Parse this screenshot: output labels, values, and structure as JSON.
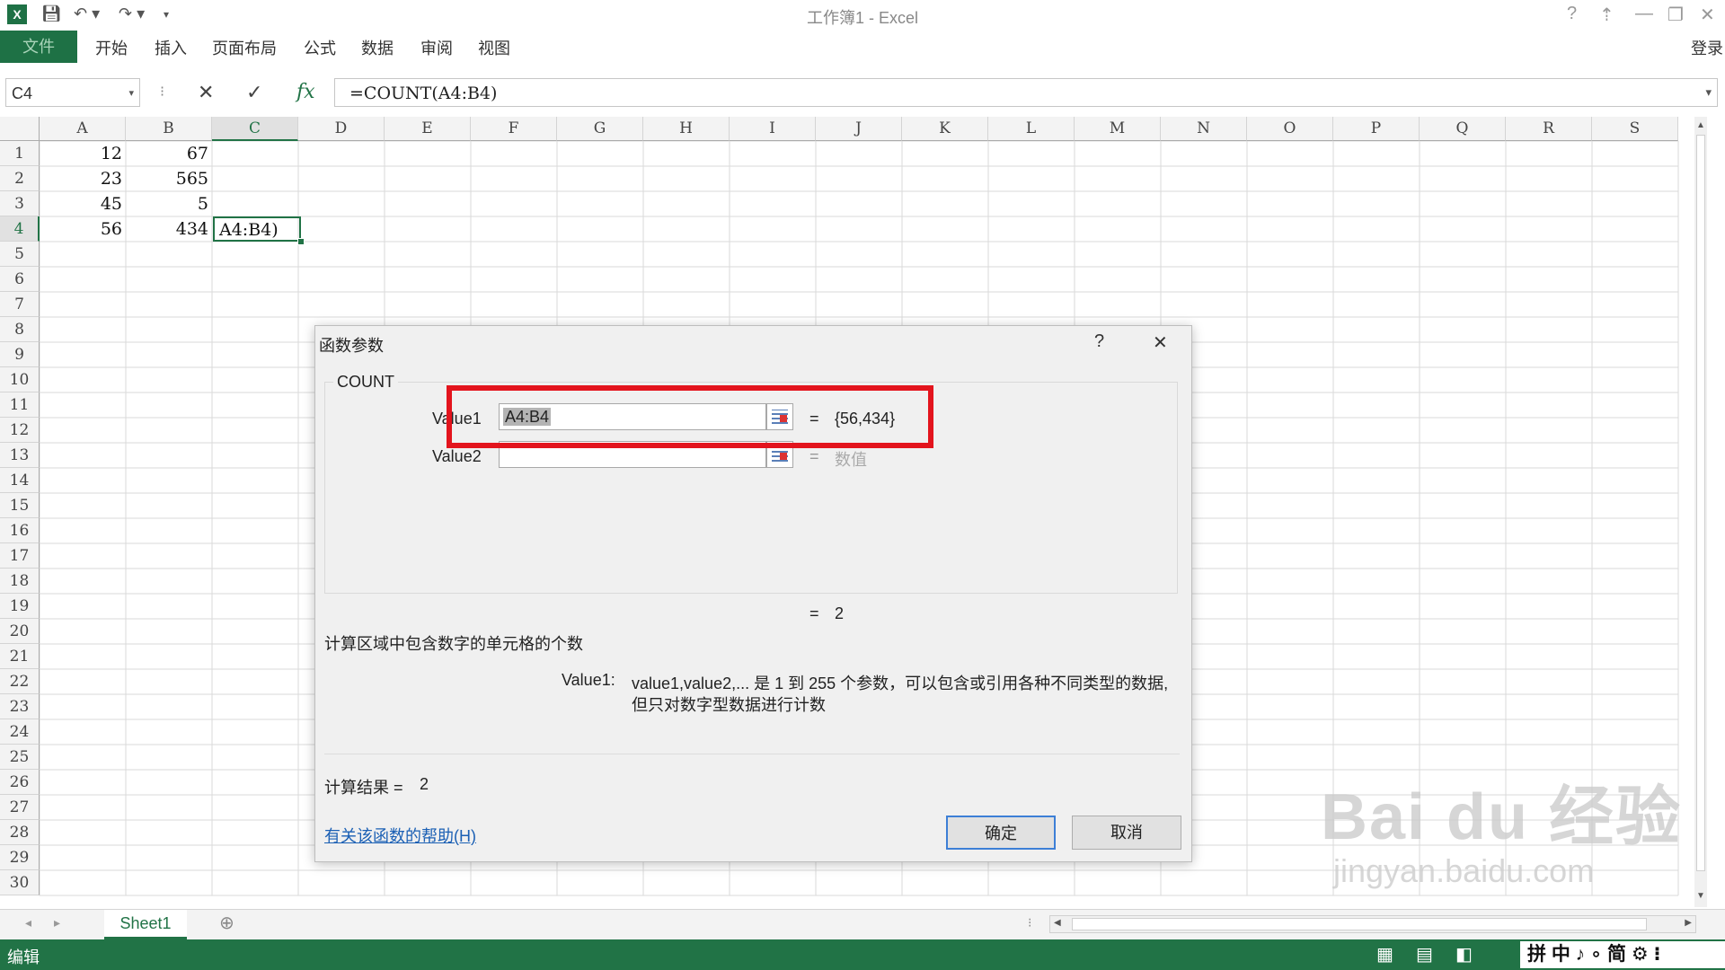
{
  "window": {
    "title": "工作簿1 - Excel",
    "login": "登录"
  },
  "ribbon": {
    "tabs": [
      "文件",
      "开始",
      "插入",
      "页面布局",
      "公式",
      "数据",
      "审阅",
      "视图"
    ]
  },
  "formula_bar": {
    "name_box": "C4",
    "formula": "=COUNT(A4:B4)"
  },
  "grid": {
    "columns": [
      "A",
      "B",
      "C",
      "D",
      "E",
      "F",
      "G",
      "H",
      "I",
      "J",
      "K",
      "L",
      "M",
      "N",
      "O",
      "P",
      "Q",
      "R",
      "S"
    ],
    "rows": [
      "1",
      "2",
      "3",
      "4",
      "5",
      "6",
      "7",
      "8",
      "9",
      "10",
      "11",
      "12",
      "13",
      "14",
      "15",
      "16",
      "17",
      "18",
      "19",
      "20",
      "21",
      "22",
      "23",
      "24",
      "25",
      "26",
      "27",
      "28",
      "29",
      "30"
    ],
    "active_cell": "C4",
    "cells": {
      "a1": "12",
      "b1": "67",
      "a2": "23",
      "b2": "565",
      "a3": "45",
      "b3": "5",
      "a4": "56",
      "b4": "434",
      "c4": "A4:B4)"
    }
  },
  "dialog": {
    "title": "函数参数",
    "help_glyph": "?",
    "close_glyph": "✕",
    "function_name": "COUNT",
    "value1_label": "Value1",
    "value1_input": "A4:B4",
    "value1_eq": "=",
    "value1_result": "{56,434}",
    "value2_label": "Value2",
    "value2_input": "",
    "value2_eq": "=",
    "value2_result": "数值",
    "func_eq": "=",
    "func_result": "2",
    "description": "计算区域中包含数字的单元格的个数",
    "param_name": "Value1:",
    "param_desc_line1": "value1,value2,... 是 1 到 255 个参数，可以包含或引用各种不同类型的数据,",
    "param_desc_line2": "但只对数字型数据进行计数",
    "calc_label": "计算结果 =",
    "calc_value": "2",
    "help_link": "有关该函数的帮助(H)",
    "ok_label": "确定",
    "cancel_label": "取消",
    "highlight_color": "#e3141d"
  },
  "sheet_tabs": {
    "active": "Sheet1"
  },
  "status_bar": {
    "mode": "编辑",
    "ime": "拼 中 ♪ ∘ 简 ⚙ ⁝"
  },
  "watermark": {
    "line1": "Bai du 经验",
    "line2": "jingyan.baidu.com"
  }
}
